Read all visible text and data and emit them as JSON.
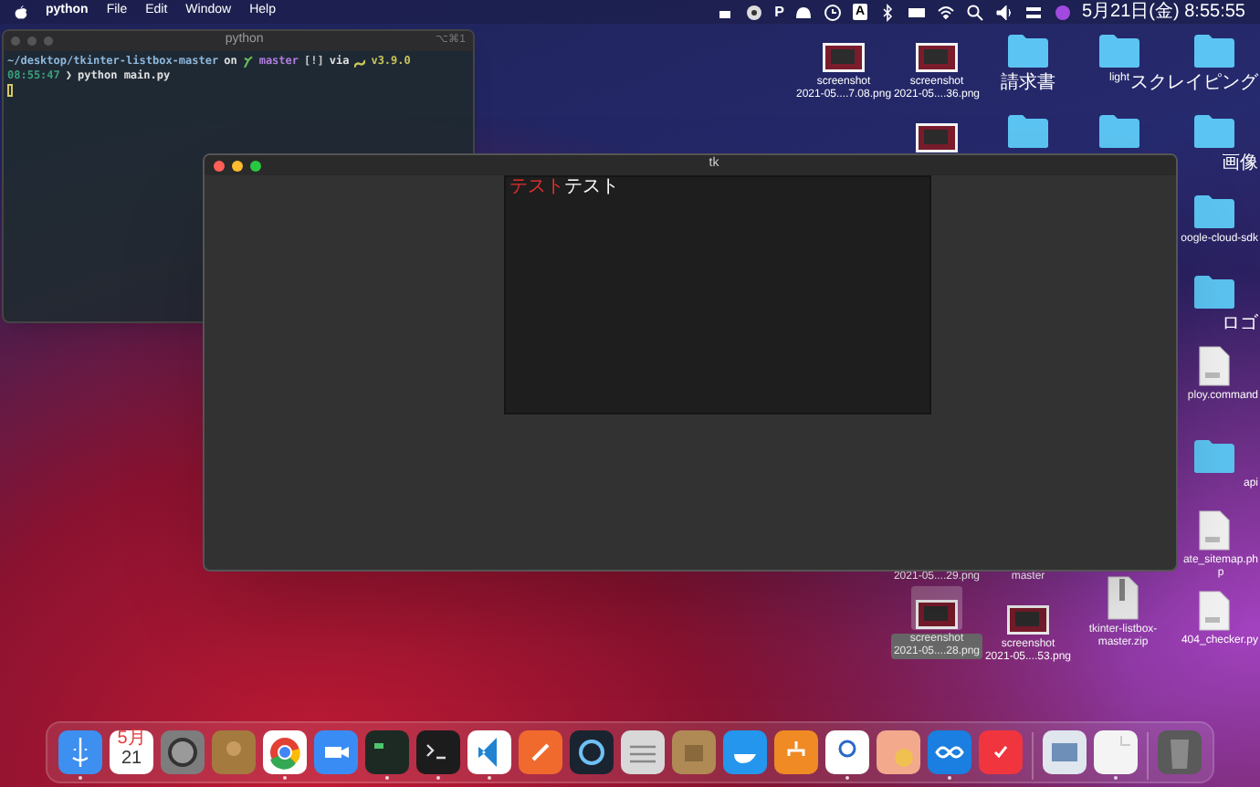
{
  "menu_bar": {
    "app": "python",
    "menus": [
      "File",
      "Edit",
      "Window",
      "Help"
    ],
    "status_items": [
      {
        "kind": "icon"
      },
      {
        "kind": "icon"
      },
      {
        "kind": "text",
        "text": "P"
      },
      {
        "kind": "icon"
      },
      {
        "kind": "icon"
      },
      {
        "kind": "boxed",
        "text": "A"
      },
      {
        "kind": "icon"
      },
      {
        "kind": "icon"
      },
      {
        "kind": "icon"
      },
      {
        "kind": "icon"
      },
      {
        "kind": "icon"
      },
      {
        "kind": "icon"
      },
      {
        "kind": "icon"
      }
    ],
    "clock": "5月21日(金) 8:55:55"
  },
  "terminal": {
    "title": "python",
    "shortcut": "⌥⌘1",
    "lines": [
      {
        "segments": [
          {
            "text": "~/desktop/tkinter-listbox-master",
            "color": "#8fb8dc"
          },
          {
            "text": "on",
            "color": "#e0e0e0"
          },
          {
            "text": "master",
            "color": "#b27fe0"
          },
          {
            "text": "[!]",
            "color": "#c8c8c8"
          },
          {
            "text": "via",
            "color": "#e0e0e0"
          },
          {
            "text": "v3.9.0",
            "color": "#c9c65a"
          }
        ]
      },
      {
        "segments": [
          {
            "text": "08:55:47",
            "color": "#3a9f7a"
          },
          {
            "text": "❯",
            "color": "#e0e0e0"
          },
          {
            "text": "python main.py",
            "color": "#e0e0e0"
          }
        ]
      }
    ],
    "cursor": true
  },
  "tk_window": {
    "title": "tk",
    "listbox": {
      "segments": [
        {
          "text": "テスト",
          "color": "#e0302e"
        },
        {
          "text": "テスト",
          "color": "#ffffff"
        }
      ]
    }
  },
  "desktop_items": [
    {
      "kind": "image",
      "label": [
        "screenshot",
        "2021-05....7.08.png"
      ],
      "selected": false
    },
    {
      "kind": "image",
      "label": [
        "screenshot",
        "2021-05....36.png"
      ],
      "selected": false
    },
    {
      "kind": "folder",
      "label": [
        "請求書"
      ],
      "selected": false
    },
    {
      "kind": "folder",
      "label": [
        "light"
      ],
      "selected": false
    },
    {
      "kind": "folder",
      "label": [
        "スクレイピング"
      ],
      "selected": false
    },
    {
      "kind": "image",
      "selected": false
    },
    {
      "kind": "folder",
      "selected": false
    },
    {
      "kind": "folder",
      "selected": false
    },
    {
      "kind": "folder",
      "label": [
        "画像"
      ],
      "selected": false
    },
    {
      "kind": "folder",
      "label": [
        "oogle-cloud-sdk"
      ],
      "selected": false
    },
    {
      "kind": "folder",
      "label": [
        "ロゴ"
      ],
      "selected": false
    },
    {
      "kind": "document",
      "label": [
        "ploy.command"
      ],
      "selected": false
    },
    {
      "kind": "folder",
      "label": [
        "api"
      ],
      "selected": false
    },
    {
      "kind": "label",
      "label": [
        "2021-05....29.png"
      ],
      "selected": false
    },
    {
      "kind": "label",
      "label": [
        "master"
      ],
      "selected": false
    },
    {
      "kind": "document",
      "label": [
        "ate_sitemap.ph",
        "p"
      ],
      "selected": false
    },
    {
      "kind": "image",
      "label": [
        "screenshot",
        "2021-05....28.png"
      ],
      "selected": true
    },
    {
      "kind": "image",
      "label": [
        "screenshot",
        "2021-05....53.png"
      ],
      "selected": false
    },
    {
      "kind": "zip",
      "label": [
        "tkinter-listbox-",
        "master.zip"
      ],
      "selected": false
    },
    {
      "kind": "document",
      "label": [
        "404_checker.py"
      ],
      "selected": false
    }
  ],
  "dock": [
    {
      "kind": "app",
      "running": true
    },
    {
      "kind": "calendar",
      "month": "5月",
      "day": "21",
      "running": false
    },
    {
      "kind": "app",
      "running": false
    },
    {
      "kind": "app",
      "running": false
    },
    {
      "kind": "app",
      "running": true
    },
    {
      "kind": "app",
      "running": false
    },
    {
      "kind": "app",
      "running": true
    },
    {
      "kind": "app",
      "running": true
    },
    {
      "kind": "app",
      "running": true
    },
    {
      "kind": "app",
      "running": false
    },
    {
      "kind": "app",
      "running": false
    },
    {
      "kind": "app",
      "running": false
    },
    {
      "kind": "app",
      "running": false
    },
    {
      "kind": "app",
      "running": false
    },
    {
      "kind": "app",
      "running": false
    },
    {
      "kind": "app",
      "running": true
    },
    {
      "kind": "app",
      "running": false
    },
    {
      "kind": "app",
      "running": true
    },
    {
      "kind": "app",
      "running": false
    },
    {
      "kind": "separator"
    },
    {
      "kind": "app",
      "running": false
    },
    {
      "kind": "app",
      "running": true
    },
    {
      "kind": "separator"
    },
    {
      "kind": "app",
      "running": false
    }
  ]
}
